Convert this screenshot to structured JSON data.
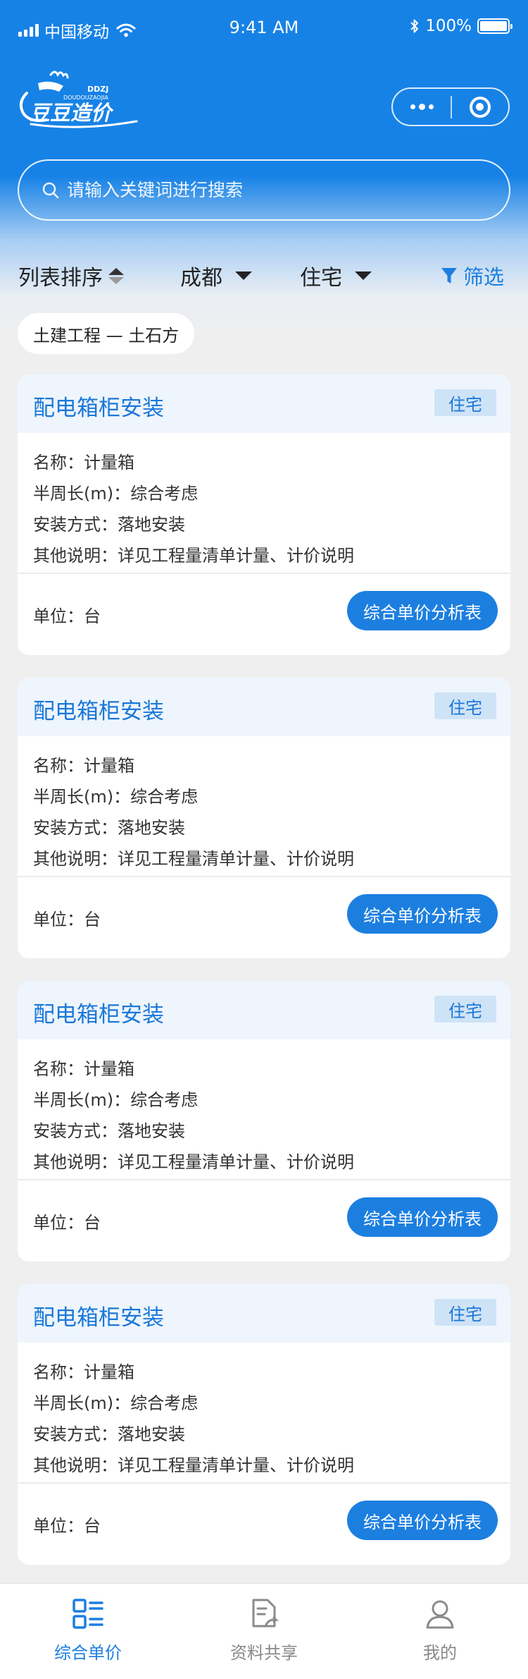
{
  "status": {
    "carrier": "中国移动",
    "time": "9:41 AM",
    "battery": "100%"
  },
  "header": {
    "logo_text": "豆豆造价",
    "logo_sub": "DOUDOUZAOJIA",
    "logo_tiny": "DDZJ"
  },
  "search": {
    "placeholder": "请输入关键词进行搜索"
  },
  "filters": {
    "sort_label": "列表排序",
    "city_label": "成都",
    "type_label": "住宅",
    "screen_label": "筛选"
  },
  "chip": {
    "label": "土建工程 — 土石方"
  },
  "cards": [
    {
      "title": "配电箱柜安装",
      "badge": "住宅",
      "rows": [
        "名称：计量箱",
        "半周长(m)：综合考虑",
        "安装方式：落地安装",
        "其他说明：详见工程量清单计量、计价说明"
      ],
      "unit": "单位：台",
      "button": "综合单价分析表"
    },
    {
      "title": "配电箱柜安装",
      "badge": "住宅",
      "rows": [
        "名称：计量箱",
        "半周长(m)：综合考虑",
        "安装方式：落地安装",
        "其他说明：详见工程量清单计量、计价说明"
      ],
      "unit": "单位：台",
      "button": "综合单价分析表"
    },
    {
      "title": "配电箱柜安装",
      "badge": "住宅",
      "rows": [
        "名称：计量箱",
        "半周长(m)：综合考虑",
        "安装方式：落地安装",
        "其他说明：详见工程量清单计量、计价说明"
      ],
      "unit": "单位：台",
      "button": "综合单价分析表"
    },
    {
      "title": "配电箱柜安装",
      "badge": "住宅",
      "rows": [
        "名称：计量箱",
        "半周长(m)：综合考虑",
        "安装方式：落地安装",
        "其他说明：详见工程量清单计量、计价说明"
      ],
      "unit": "单位：台",
      "button": "综合单价分析表"
    }
  ],
  "tabbar": {
    "items": [
      {
        "label": "综合单价",
        "icon": "grid-list-icon",
        "active": true
      },
      {
        "label": "资料共享",
        "icon": "document-share-icon",
        "active": false
      },
      {
        "label": "我的",
        "icon": "user-icon",
        "active": false
      }
    ]
  },
  "colors": {
    "primary": "#1c7fe0",
    "header_bg": "#1782e6",
    "badge_bg": "#cfe3f7",
    "card_head_bg": "#eef5fd"
  }
}
